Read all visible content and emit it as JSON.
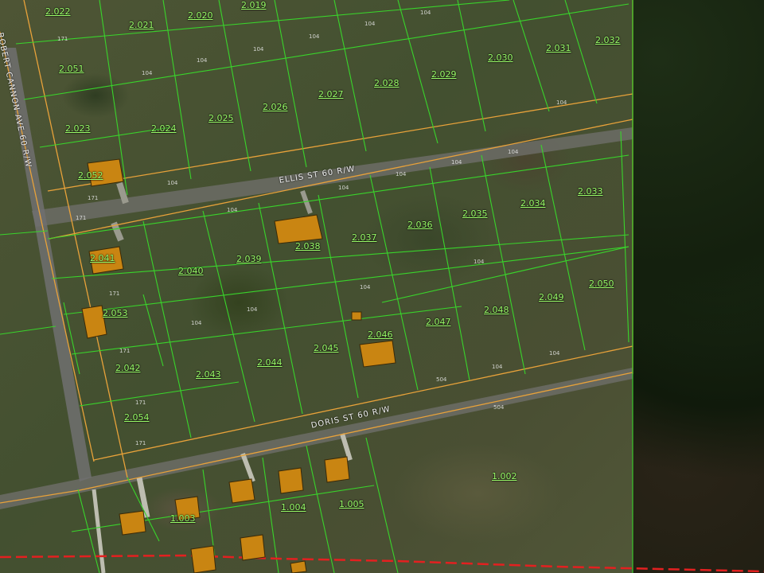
{
  "colors": {
    "parcel_line": "#39d42b",
    "row_line": "#e8a23a",
    "boundary_line": "#e32020",
    "building": "#c98512",
    "road_surface": "#6e6e6e",
    "label": "#9cff6a"
  },
  "roads": {
    "ellis": "ELLIS ST 60 R/W",
    "doris": "DORIS ST 60 R/W",
    "cannon": "ROBERT CANNON AVE 60 R/W"
  },
  "lots": [
    "2.022",
    "2.021",
    "2.020",
    "2.019",
    "2.051",
    "2.030",
    "2.031",
    "2.032",
    "2.023",
    "2.024",
    "2.025",
    "2.026",
    "2.027",
    "2.028",
    "2.029",
    "2.052",
    "2.033",
    "2.034",
    "2.035",
    "2.036",
    "2.037",
    "2.038",
    "2.039",
    "2.040",
    "2.041",
    "2.053",
    "2.050",
    "2.049",
    "2.048",
    "2.047",
    "2.046",
    "2.045",
    "2.044",
    "2.043",
    "2.042",
    "2.054",
    "1.002",
    "1.003",
    "1.004",
    "1.005"
  ],
  "dims": [
    "171",
    "104",
    "104",
    "104",
    "104",
    "104",
    "104",
    "104",
    "104",
    "104",
    "104",
    "171",
    "104",
    "104",
    "104",
    "104",
    "104",
    "104",
    "104",
    "104",
    "104",
    "171",
    "171",
    "171",
    "171",
    "504",
    "504",
    "171"
  ]
}
